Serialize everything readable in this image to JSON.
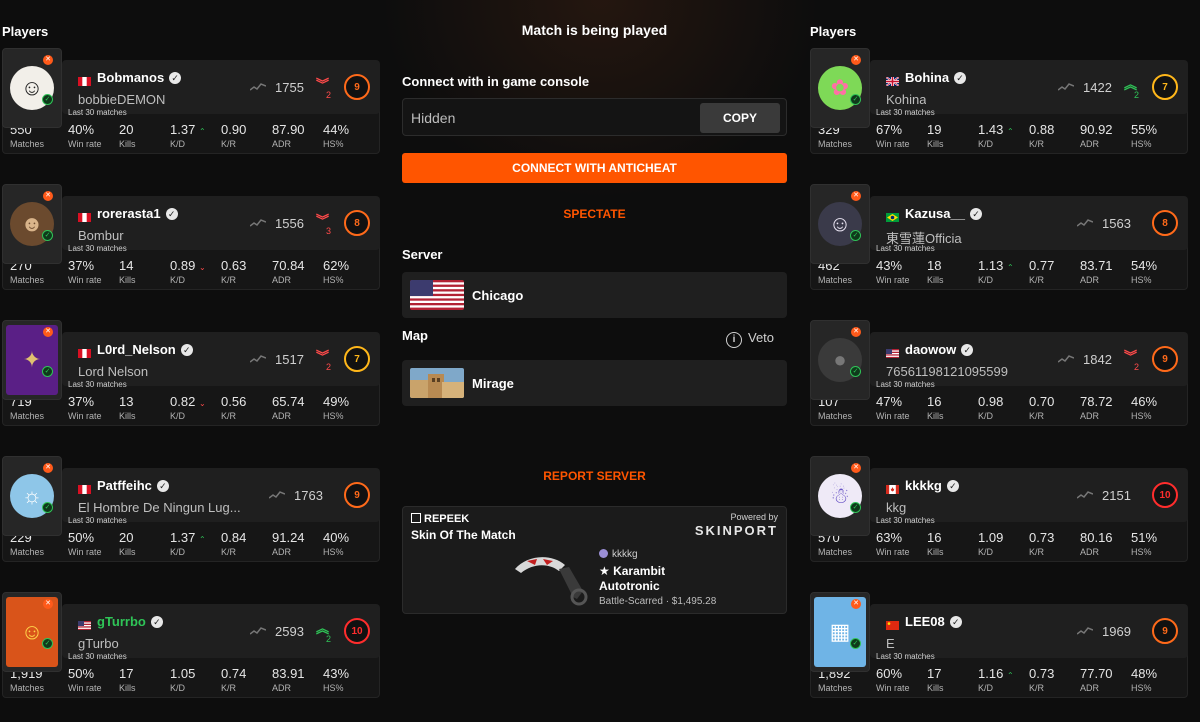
{
  "left_title": "Players",
  "right_title": "Players",
  "center": {
    "title": "Match is being played",
    "connect_label": "Connect with in game console",
    "console_value": "Hidden",
    "copy_label": "COPY",
    "anticheat_label": "CONNECT WITH ANTICHEAT",
    "spectate_label": "SPECTATE",
    "server_label": "Server",
    "server_value": "Chicago",
    "map_label": "Map",
    "veto_label": "Veto",
    "map_value": "Mirage",
    "report_label": "REPORT SERVER"
  },
  "skin": {
    "brand": "REPEEK",
    "title": "Skin Of The Match",
    "powered": "Powered by",
    "sponsor": "SKINPORT",
    "owner": "kkkkg",
    "item_line1": "★ Karambit",
    "item_line2": "Autotronic",
    "condition": "Battle-Scarred · $1,495.28"
  },
  "colors": {
    "accent": "#ff5500",
    "positive": "#2fc457",
    "negative": "#ff4a4a"
  },
  "stat_labels": {
    "last30": "Last 30 matches",
    "matches": "Matches",
    "winrate": "Win rate",
    "kills": "Kills",
    "kd": "K/D",
    "kr": "K/R",
    "adr": "ADR",
    "hs": "HS%"
  },
  "left_players": [
    {
      "nick": "Bobmanos",
      "sub": "bobbieDEMON",
      "flag": "peru",
      "elo": "1755",
      "trend": "down",
      "trend_num": "2",
      "level": "9",
      "matches": "550",
      "winrate": "40%",
      "kills": "20",
      "kd": "1.37",
      "kd_trend": "up",
      "kr": "0.90",
      "adr": "87.90",
      "hs": "44%",
      "avatar_icon": "clown-icon"
    },
    {
      "nick": "rorerasta1",
      "sub": "Bombur",
      "flag": "peru",
      "elo": "1556",
      "trend": "down",
      "trend_num": "3",
      "level": "8",
      "matches": "270",
      "winrate": "37%",
      "kills": "14",
      "kd": "0.89",
      "kd_trend": "down",
      "kr": "0.63",
      "adr": "70.84",
      "hs": "62%",
      "avatar_icon": "dwarf-icon"
    },
    {
      "nick": "L0rd_Nelson",
      "sub": "Lord Nelson",
      "flag": "peru",
      "elo": "1517",
      "trend": "down",
      "trend_num": "2",
      "level": "7",
      "matches": "719",
      "winrate": "37%",
      "kills": "13",
      "kd": "0.82",
      "kd_trend": "down",
      "kr": "0.56",
      "adr": "65.74",
      "hs": "49%",
      "avatar_icon": "team-logo-icon"
    },
    {
      "nick": "Patffeihc",
      "sub": "El Hombre De Ningun Lug...",
      "flag": "peru",
      "elo": "1763",
      "trend": "",
      "trend_num": "",
      "level": "9",
      "matches": "229",
      "winrate": "50%",
      "kills": "20",
      "kd": "1.37",
      "kd_trend": "up",
      "kr": "0.84",
      "adr": "91.24",
      "hs": "40%",
      "avatar_icon": "cartoon-icon"
    },
    {
      "nick": "gTurrbo",
      "sub": "gTurbo",
      "flag": "usa",
      "elo": "2593",
      "trend": "up",
      "trend_num": "2",
      "level": "10",
      "matches": "1,919",
      "winrate": "50%",
      "kills": "17",
      "kd": "1.05",
      "kd_trend": "",
      "kr": "0.74",
      "adr": "83.91",
      "hs": "43%",
      "avatar_icon": "fire-portrait-icon",
      "nick_color": "#2fc457"
    }
  ],
  "right_players": [
    {
      "nick": "Bohina",
      "sub": "Kohina",
      "flag": "uk",
      "elo": "1422",
      "trend": "up",
      "trend_num": "2",
      "level": "7",
      "matches": "329",
      "winrate": "67%",
      "kills": "19",
      "kd": "1.43",
      "kd_trend": "up",
      "kr": "0.88",
      "adr": "90.92",
      "hs": "55%",
      "avatar_icon": "anime-icon"
    },
    {
      "nick": "Kazusa__",
      "sub": "東雪蓮Officia",
      "flag": "brazil",
      "elo": "1563",
      "trend": "",
      "trend_num": "",
      "level": "8",
      "matches": "462",
      "winrate": "43%",
      "kills": "18",
      "kd": "1.13",
      "kd_trend": "up",
      "kr": "0.77",
      "adr": "83.71",
      "hs": "54%",
      "avatar_icon": "anime-girl-icon"
    },
    {
      "nick": "daowow",
      "sub": "76561198121095599",
      "flag": "usa",
      "elo": "1842",
      "trend": "down",
      "trend_num": "2",
      "level": "9",
      "matches": "107",
      "winrate": "47%",
      "kills": "16",
      "kd": "0.98",
      "kd_trend": "",
      "kr": "0.70",
      "adr": "78.72",
      "hs": "46%",
      "avatar_icon": "default-user-icon"
    },
    {
      "nick": "kkkkg",
      "sub": "kkg",
      "flag": "canada",
      "elo": "2151",
      "trend": "",
      "trend_num": "",
      "level": "10",
      "matches": "570",
      "winrate": "63%",
      "kills": "16",
      "kd": "1.09",
      "kd_trend": "",
      "kr": "0.73",
      "adr": "80.16",
      "hs": "51%",
      "avatar_icon": "cartoon-ghost-icon"
    },
    {
      "nick": "LEE08",
      "sub": "E",
      "flag": "china",
      "elo": "1969",
      "trend": "",
      "trend_num": "",
      "level": "9",
      "matches": "1,892",
      "winrate": "60%",
      "kills": "17",
      "kd": "1.16",
      "kd_trend": "up",
      "kr": "0.73",
      "adr": "77.70",
      "hs": "48%",
      "avatar_icon": "city-icon"
    }
  ]
}
